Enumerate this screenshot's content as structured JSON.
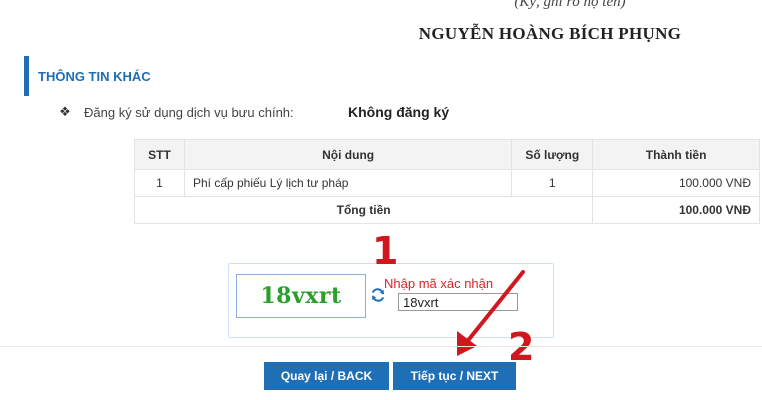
{
  "signature": {
    "caption": "(Ký, ghi rõ họ tên)",
    "name": "NGUYỄN HOÀNG BÍCH PHỤNG"
  },
  "section": {
    "title": "THÔNG TIN KHÁC"
  },
  "postal": {
    "bullet_icon": "diamond-bullet-icon",
    "label": "Đăng ký sử dụng dịch vụ bưu chính:",
    "value": "Không đăng ký"
  },
  "fees_table": {
    "headers": [
      "STT",
      "Nội dung",
      "Số lượng",
      "Thành tiền"
    ],
    "rows": [
      {
        "stt": "1",
        "content": "Phí cấp phiếu Lý lịch tư pháp",
        "quantity": "1",
        "amount": "100.000 VNĐ"
      }
    ],
    "total_label": "Tổng tiền",
    "total_value": "100.000 VNĐ"
  },
  "captcha": {
    "image_text": "18vxrt",
    "refresh_icon": "refresh-icon",
    "label": "Nhập mã xác nhận",
    "input_value": "18vxrt"
  },
  "annotations": {
    "step1": "1",
    "step2": "2",
    "color": "#d2161e"
  },
  "buttons": {
    "back": "Quay lại / BACK",
    "next": "Tiếp tục / NEXT"
  },
  "colors": {
    "accent": "#1e6db5",
    "button": "#1f6fb7",
    "captcha_text": "#2aa02a",
    "captcha_label": "#d9232a"
  }
}
